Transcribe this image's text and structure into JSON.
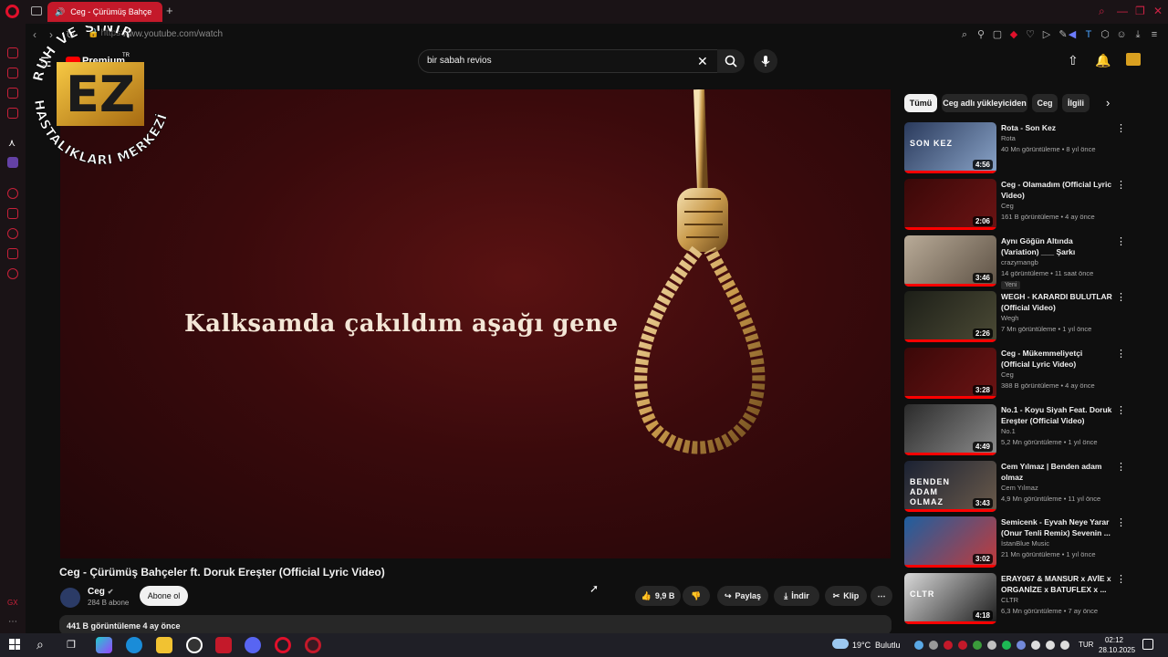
{
  "browser": {
    "tab_title": "Ceg - Çürümüş Bahçe",
    "url_prefix": "https://",
    "url": "www.youtube.com/watch",
    "new_tab": "+"
  },
  "yt_header": {
    "logo_text": "Premium",
    "search_value": "bir sabah revios"
  },
  "watermark": {
    "text_top": "RUH VE SİNİR",
    "text_bottom": "HASTALIKLARI MERKEZİ",
    "logo_letters": "EZ",
    "tm": "TR"
  },
  "video": {
    "lyric": "Kalksamda çakıldım aşağı gene",
    "title": "Ceg - Çürümüş Bahçeler ft. Doruk Ereşter (Official Lyric Video)",
    "channel": "Ceg",
    "subscribers": "284 B abone",
    "subscribe_label": "Abone ol",
    "likes": "9,9 B",
    "share_label": "Paylaş",
    "download_label": "İndir",
    "clip_label": "Klip",
    "views_date": "441 B görüntüleme  4 ay önce"
  },
  "chips": [
    "Tümü",
    "Ceg adlı yükleyiciden",
    "Ceg",
    "İlgili"
  ],
  "recommendations": [
    {
      "title": "Rota - Son Kez",
      "channel": "Rota",
      "meta": "40 Mn görüntüleme • 8 yıl önce",
      "duration": "4:56",
      "thumb_text": "SON KEZ",
      "badge": "",
      "colors": [
        "#2a3a5c",
        "#8aa4c8"
      ]
    },
    {
      "title": "Ceg - Olamadım (Official Lyric Video)",
      "channel": "Ceg",
      "meta": "161 B görüntüleme • 4 ay önce",
      "duration": "2:06",
      "thumb_text": "",
      "badge": "",
      "colors": [
        "#3a0808",
        "#6b1414"
      ]
    },
    {
      "title": "Aynı Göğün Altında (Variation) ___ Şarkı",
      "channel": "crazymangb",
      "meta": "14 görüntüleme • 11 saat önce",
      "duration": "3:46",
      "thumb_text": "",
      "badge": "Yeni",
      "colors": [
        "#b9ab98",
        "#5d5144"
      ]
    },
    {
      "title": "WEGH - KARARDI BULUTLAR (Official Video)",
      "channel": "Wegh",
      "meta": "7 Mn görüntüleme • 1 yıl önce",
      "duration": "2:26",
      "thumb_text": "",
      "badge": "",
      "colors": [
        "#1d1f18",
        "#4b4a35"
      ]
    },
    {
      "title": "Ceg - Mükemmeliyetçi (Official Lyric Video)",
      "channel": "Ceg",
      "meta": "388 B görüntüleme • 4 ay önce",
      "duration": "3:28",
      "thumb_text": "",
      "badge": "",
      "colors": [
        "#3a0808",
        "#6b1414"
      ]
    },
    {
      "title": "No.1 - Koyu Siyah Feat. Doruk Ereşter (Official Video)",
      "channel": "No.1",
      "meta": "5,2 Mn görüntüleme • 1 yıl önce",
      "duration": "4:49",
      "thumb_text": "",
      "badge": "",
      "colors": [
        "#2b2b2b",
        "#8c8c8c"
      ]
    },
    {
      "title": "Cem Yılmaz | Benden adam olmaz",
      "channel": "Cem Yılmaz",
      "meta": "4,9 Mn görüntüleme • 11 yıl önce",
      "duration": "3:43",
      "thumb_text": "BENDEN ADAM OLMAZ",
      "badge": "",
      "colors": [
        "#1b2233",
        "#6a5a4a"
      ]
    },
    {
      "title": "Semicenk - Eyvah Neye Yarar (Onur Tenli Remix) Sevenin ...",
      "channel": "İstanBlue Music",
      "meta": "21 Mn görüntüleme • 1 yıl önce",
      "duration": "3:02",
      "thumb_text": "",
      "badge": "",
      "colors": [
        "#1d5fa0",
        "#c43a3a"
      ]
    },
    {
      "title": "ERAY067 & MANSUR x AVİE x ORGANİZE x BATUFLEX x ...",
      "channel": "CLTR",
      "meta": "6,3 Mn görüntüleme • 7 ay önce",
      "duration": "4:18",
      "thumb_text": "CLTR",
      "badge": "",
      "colors": [
        "#d9d9d9",
        "#1a1a1a"
      ]
    }
  ],
  "taskbar": {
    "weather_temp": "19°C",
    "weather_cond": "Bulutlu",
    "lang": "TUR",
    "time": "02:12",
    "date": "28.10.2025"
  }
}
